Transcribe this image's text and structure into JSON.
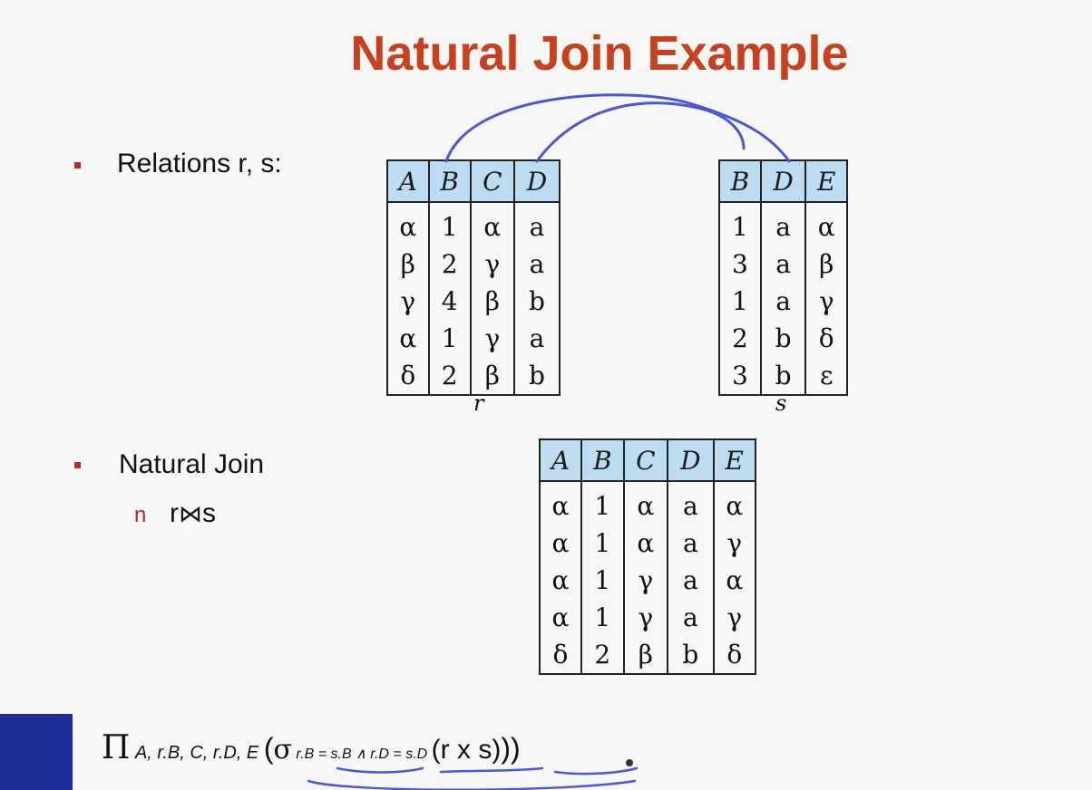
{
  "slide": {
    "title": "Natural Join Example",
    "bullet1": "Relations r, s:",
    "bullet2": "Natural Join",
    "sub_marker": "n",
    "sub_text_r": "r",
    "sub_join_symbol": "⋈",
    "sub_text_s": "s"
  },
  "relation_r": {
    "caption": "r",
    "headers": [
      "A",
      "B",
      "C",
      "D"
    ],
    "rows": [
      [
        "α",
        "1",
        "α",
        "a"
      ],
      [
        "β",
        "2",
        "γ",
        "a"
      ],
      [
        "γ",
        "4",
        "β",
        "b"
      ],
      [
        "α",
        "1",
        "γ",
        "a"
      ],
      [
        "δ",
        "2",
        "β",
        "b"
      ]
    ]
  },
  "relation_s": {
    "caption": "s",
    "headers": [
      "B",
      "D",
      "E"
    ],
    "rows": [
      [
        "1",
        "a",
        "α"
      ],
      [
        "3",
        "a",
        "β"
      ],
      [
        "1",
        "a",
        "γ"
      ],
      [
        "2",
        "b",
        "δ"
      ],
      [
        "3",
        "b",
        "ε"
      ]
    ]
  },
  "result": {
    "headers": [
      "A",
      "B",
      "C",
      "D",
      "E"
    ],
    "rows": [
      [
        "α",
        "1",
        "α",
        "a",
        "α"
      ],
      [
        "α",
        "1",
        "α",
        "a",
        "γ"
      ],
      [
        "α",
        "1",
        "γ",
        "a",
        "α"
      ],
      [
        "α",
        "1",
        "γ",
        "a",
        "γ"
      ],
      [
        "δ",
        "2",
        "β",
        "b",
        "δ"
      ]
    ]
  },
  "formula": {
    "pi": "Π",
    "proj_list": " A, r.B, C, r.D, E ",
    "open": "(",
    "sigma": "σ",
    "cond1": "r.B = s.B",
    "and": "∧",
    "cond2": "r.D = s.D",
    "rxs": "(r x s)",
    "close": "))"
  },
  "colors": {
    "title": "#c8401e",
    "bullet": "#b22a2a",
    "header_fill": "#bcdcf1",
    "pen": "#4b57d6",
    "left_bar": "#1f2b96"
  }
}
